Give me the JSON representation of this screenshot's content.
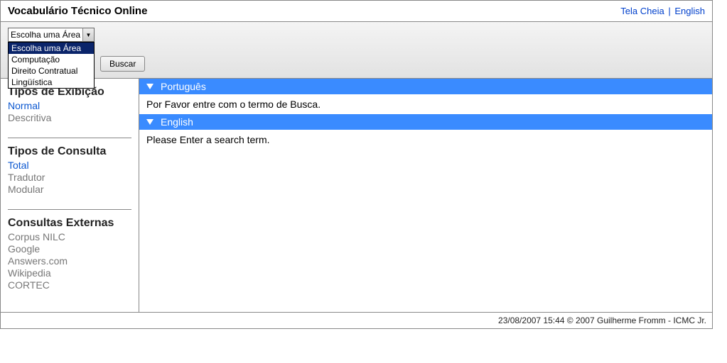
{
  "header": {
    "title": "Vocabulário Técnico Online",
    "fullscreen": "Tela Cheia",
    "english": "English"
  },
  "toolbar": {
    "area_select_label": "Escolha uma Área",
    "search_label": "Buscar",
    "options": [
      "Escolha uma Área",
      "Computação",
      "Direito Contratual",
      "Lingüística"
    ]
  },
  "sidebar": {
    "exibicao_heading": "Tipos de Exibição",
    "exibicao": [
      {
        "label": "Normal",
        "active": true
      },
      {
        "label": "Descritiva",
        "active": false
      }
    ],
    "consulta_heading": "Tipos de Consulta",
    "consulta": [
      {
        "label": "Total",
        "active": true
      },
      {
        "label": "Tradutor",
        "active": false
      },
      {
        "label": "Modular",
        "active": false
      }
    ],
    "externas_heading": "Consultas Externas",
    "externas": [
      {
        "label": "Corpus NILC"
      },
      {
        "label": "Google"
      },
      {
        "label": "Answers.com"
      },
      {
        "label": "Wikipedia"
      },
      {
        "label": "CORTEC"
      }
    ]
  },
  "main": {
    "pt_label": "Português",
    "pt_msg": "Por Favor entre com o termo de Busca.",
    "en_label": "English",
    "en_msg": "Please Enter a search term."
  },
  "footer": "23/08/2007 15:44 © 2007 Guilherme Fromm - ICMC Jr."
}
